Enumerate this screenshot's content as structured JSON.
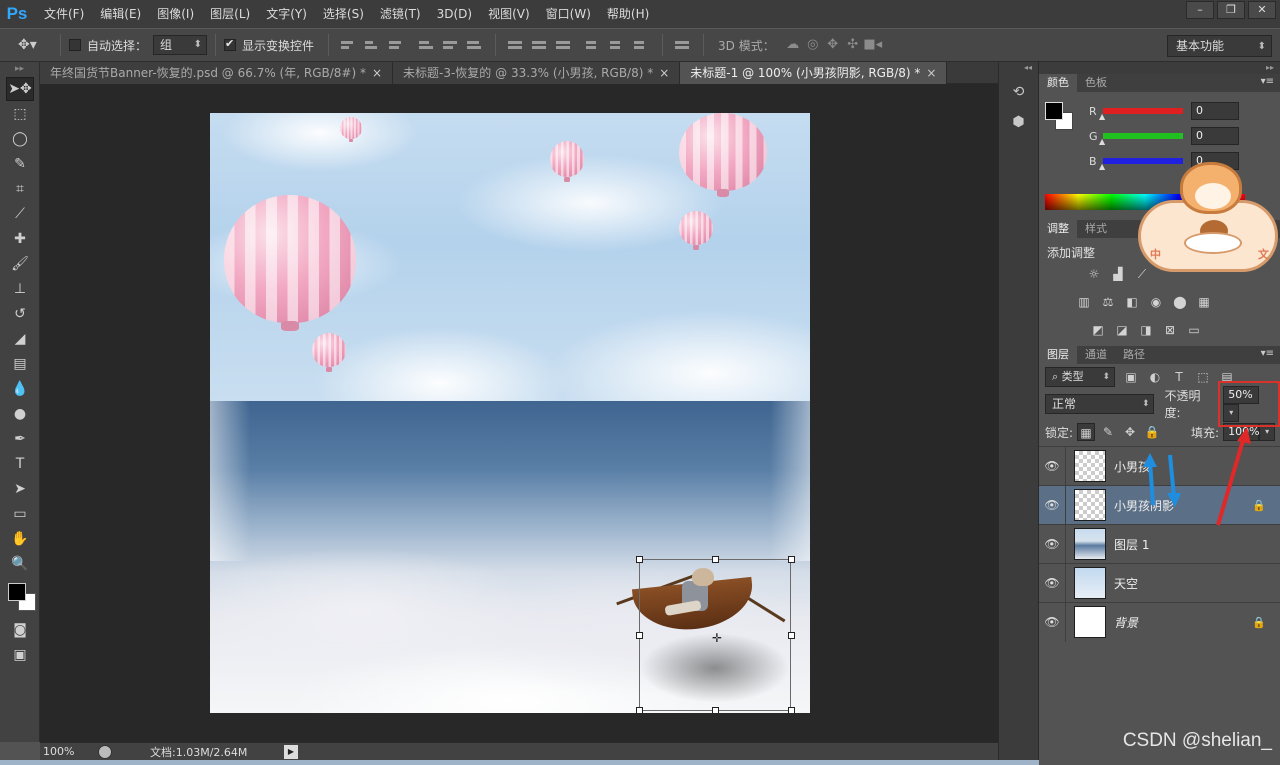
{
  "app": {
    "logo": "Ps"
  },
  "menu": [
    "文件(F)",
    "编辑(E)",
    "图像(I)",
    "图层(L)",
    "文字(Y)",
    "选择(S)",
    "滤镜(T)",
    "3D(D)",
    "视图(V)",
    "窗口(W)",
    "帮助(H)"
  ],
  "window_controls": {
    "minimize": "–",
    "restore": "❐",
    "close": "✕"
  },
  "options": {
    "auto_select_label": "自动选择：",
    "auto_select_checked": false,
    "auto_select_value": "组",
    "show_transform_label": "显示变换控件",
    "show_transform_checked": true,
    "mode_3d_label": "3D 模式：",
    "workspace": "基本功能"
  },
  "tabs": [
    {
      "label": "年终国货节Banner-恢复的.psd @ 66.7% (年, RGB/8#) *",
      "active": false
    },
    {
      "label": "未标题-3-恢复的 @ 33.3% (小男孩, RGB/8) *",
      "active": false
    },
    {
      "label": "未标题-1 @ 100% (小男孩阴影, RGB/8) *",
      "active": true
    }
  ],
  "tab_close": "×",
  "status": {
    "zoom": "100%",
    "doc": "文档:1.03M/2.64M",
    "arrow": "▶"
  },
  "color_panel": {
    "tabs": [
      "颜色",
      "色板"
    ],
    "channels": [
      {
        "letter": "R",
        "value": "0",
        "color": "#e02020"
      },
      {
        "letter": "G",
        "value": "0",
        "color": "#20c020"
      },
      {
        "letter": "B",
        "value": "0",
        "color": "#2020e0"
      }
    ]
  },
  "adjust_panel": {
    "tabs": [
      "调整",
      "样式"
    ],
    "title": "添加调整"
  },
  "mascot": {
    "left": "中",
    "right": "文"
  },
  "layers_panel": {
    "tabs": [
      "图层",
      "通道",
      "路径"
    ],
    "filter": "类型",
    "blend_mode": "正常",
    "opacity_label": "不透明度:",
    "opacity_value": "50%",
    "lock_label": "锁定:",
    "fill_label": "填充:",
    "fill_value": "100%",
    "layers": [
      {
        "name": "小男孩",
        "selected": false,
        "locked": false,
        "thumb": "transparent"
      },
      {
        "name": "小男孩阴影",
        "selected": true,
        "locked": true,
        "thumb": "transparent"
      },
      {
        "name": "图层 1",
        "selected": false,
        "locked": false,
        "thumb": "sky"
      },
      {
        "name": "天空",
        "selected": false,
        "locked": false,
        "thumb": "sky2"
      },
      {
        "name": "背景",
        "selected": false,
        "locked": true,
        "thumb": "white",
        "italic": true
      }
    ]
  },
  "watermark": "CSDN @shelian_"
}
